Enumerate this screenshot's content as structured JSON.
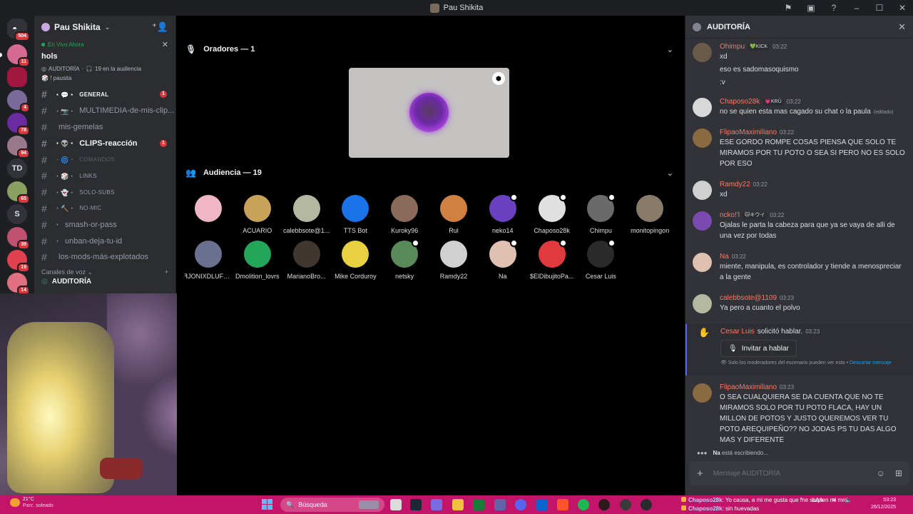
{
  "window": {
    "title": "Pau Shikita"
  },
  "rail": {
    "badges": [
      "504",
      "11",
      "4",
      "78",
      "94",
      "65",
      "39",
      "19",
      "14"
    ],
    "text_servers": [
      "TD",
      "S"
    ]
  },
  "sidebar": {
    "guild_name": "Pau Shikita",
    "live": {
      "header": "En Vivo Ahora",
      "title": "hols",
      "channel": "AUDITORÍA",
      "audience": "19 en la audiencia",
      "pausa": "! pausita"
    },
    "channels": [
      {
        "name": "GENERAL",
        "prefix": "・💬・",
        "count": "1",
        "state": "unread"
      },
      {
        "name": "MULTIMEDIA-de-mis-clip...",
        "prefix": "・📷・",
        "count": "",
        "state": "normal"
      },
      {
        "name": "mis-gemelas",
        "prefix": "",
        "count": "",
        "state": "normal"
      },
      {
        "name": "CLIPS-reacción",
        "prefix": "・👽・",
        "count": "1",
        "state": "unread"
      },
      {
        "name": "COMANDOS",
        "prefix": "・🌀・",
        "count": "",
        "state": "muted"
      },
      {
        "name": "LINKS",
        "prefix": "・🎲・",
        "count": "",
        "state": "normal"
      },
      {
        "name": "SOLO-SUBS",
        "prefix": "・👻・",
        "count": "",
        "state": "normal"
      },
      {
        "name": "NO-MIC",
        "prefix": "・🔨・",
        "count": "",
        "state": "normal"
      },
      {
        "name": "smash-or-pass",
        "prefix": "・",
        "count": "",
        "state": "normal"
      },
      {
        "name": "unban-deja-tu-id",
        "prefix": "・",
        "count": "",
        "state": "normal"
      },
      {
        "name": "los-mods-más-explotados",
        "prefix": "",
        "count": "",
        "state": "normal"
      }
    ],
    "voice_header": "Canales de voz",
    "voice_channel": "AUDITORÍA"
  },
  "stage": {
    "speakers_label": "Oradores — 1",
    "audience_label": "Audiencia — 19",
    "audience": [
      {
        "name": "",
        "color": "#f0b6c8",
        "mod": false
      },
      {
        "name": "ACUARIO",
        "color": "#c9a25a",
        "mod": false
      },
      {
        "name": "calebbsote@1...",
        "color": "#b5b8a0",
        "mod": false
      },
      {
        "name": "TTS Bot",
        "color": "#1a73e8",
        "mod": false
      },
      {
        "name": "Kuroky96",
        "color": "#8a6a5a",
        "mod": false
      },
      {
        "name": "Rul",
        "color": "#d08040",
        "mod": false
      },
      {
        "name": "neko14",
        "color": "#6a40c0",
        "mod": true
      },
      {
        "name": "Chaposo28k",
        "color": "#e0e0e0",
        "mod": true
      },
      {
        "name": "Chimpu",
        "color": "#6a6a6a",
        "mod": true
      },
      {
        "name": "monitopingon",
        "color": "#8a7a6a",
        "mod": false
      },
      {
        "name": "ꟻJONIXDLUFFY...",
        "color": "#6a7090",
        "mod": false
      },
      {
        "name": "Dmolition_lovrs",
        "color": "#23a55a",
        "mod": false
      },
      {
        "name": "MarianoBro...",
        "color": "#403830",
        "mod": false
      },
      {
        "name": "Mike Corduroy",
        "color": "#e8d040",
        "mod": false
      },
      {
        "name": "netsky",
        "color": "#5a8a5a",
        "mod": true
      },
      {
        "name": "Ramdy22",
        "color": "#d0d0d0",
        "mod": false
      },
      {
        "name": "Na",
        "color": "#e0c0b0",
        "mod": true
      },
      {
        "name": "$ElDibujitoPa...",
        "color": "#e03a3e",
        "mod": true
      },
      {
        "name": "Cesar Luis",
        "color": "#2a2a2a",
        "mod": true
      }
    ]
  },
  "panel": {
    "title": "AUDITORÍA",
    "messages": [
      {
        "user": "Ohimpu",
        "tag": "💚KICK",
        "time": "03:22",
        "lines": [
          "xd",
          "eso es sadomasoquismo",
          ":v"
        ],
        "color": "#6a5a4a",
        "edited": ""
      },
      {
        "user": "Chaposo28k",
        "tag": "💗KRÜ",
        "time": "03:22",
        "lines": [
          "no se quien esta mas cagado su chat o la paula"
        ],
        "color": "#d8d8d8",
        "edited": "(editado)"
      },
      {
        "user": "FlipaoMaximiliano",
        "tag": "",
        "time": "03:22",
        "lines": [
          "ESE GORDO ROMPE COSAS  PIENSA QUE SOLO TE MIRAMOS POR TU POTO O SEA SI PERO NO ES SOLO POR ESO"
        ],
        "color": "#8a6a40",
        "edited": ""
      },
      {
        "user": "Ramdy22",
        "tag": "",
        "time": "03:22",
        "lines": [
          "xd"
        ],
        "color": "#d0d0d0",
        "edited": ""
      },
      {
        "user": "ncko!'l",
        "tag": "🐱キウイ",
        "time": "03:22",
        "lines": [
          "Ojalas le parta la cabeza para que ya se vaya de alli de una vez por todas"
        ],
        "color": "#7a4ab0",
        "edited": ""
      },
      {
        "user": "Na",
        "tag": "",
        "time": "03:22",
        "lines": [
          "miente, manipula, es controlador y tiende a menospreciar a la gente"
        ],
        "color": "#e0c0b0",
        "edited": ""
      },
      {
        "user": "calebbsote@1109",
        "tag": "",
        "time": "03:23",
        "lines": [
          "Ya pero a cuanto el polvo"
        ],
        "color": "#b5b8a0",
        "edited": ""
      },
      {
        "user": "FlipaoMaximiliano",
        "tag": "",
        "time": "03:23",
        "lines": [
          "O SEA CUALQUIERA SE DA CUENTA QUE NO TE MIRAMOS SOLO POR TU POTO FLACA, HAY UN MILLON DE POTOS Y JUSTO QUEREMOS VER TU POTO AREQUIPEÑO?? NO JODAS PS TU DAS ALGO MAS Y DIFERENTE"
        ],
        "color": "#8a6a40",
        "edited": ""
      }
    ],
    "request": {
      "user": "Cesar Luis",
      "text": "solicitó hablar.",
      "time": "03:23",
      "button": "Invitar a hablar",
      "note": "Solo los moderadores del escenario pueden ver esto •",
      "link": "Descartar mensaje"
    },
    "typing_user": "Na",
    "typing_text": "está escribiendo...",
    "composer_placeholder": "Mensaje AUDITORÍA"
  },
  "taskbar": {
    "temp": "21°C",
    "weather": "Parc. soleado",
    "search": "Búsqueda",
    "chat": [
      {
        "user": "Chaposo28k",
        "text": ": Yo causa, a mi me gusta que me saquen mi mrd"
      },
      {
        "user": "Chaposo28k",
        "text": ": sin huevadas"
      }
    ],
    "lang": "LAA",
    "time": "03:23",
    "date": "26/12/2025"
  }
}
